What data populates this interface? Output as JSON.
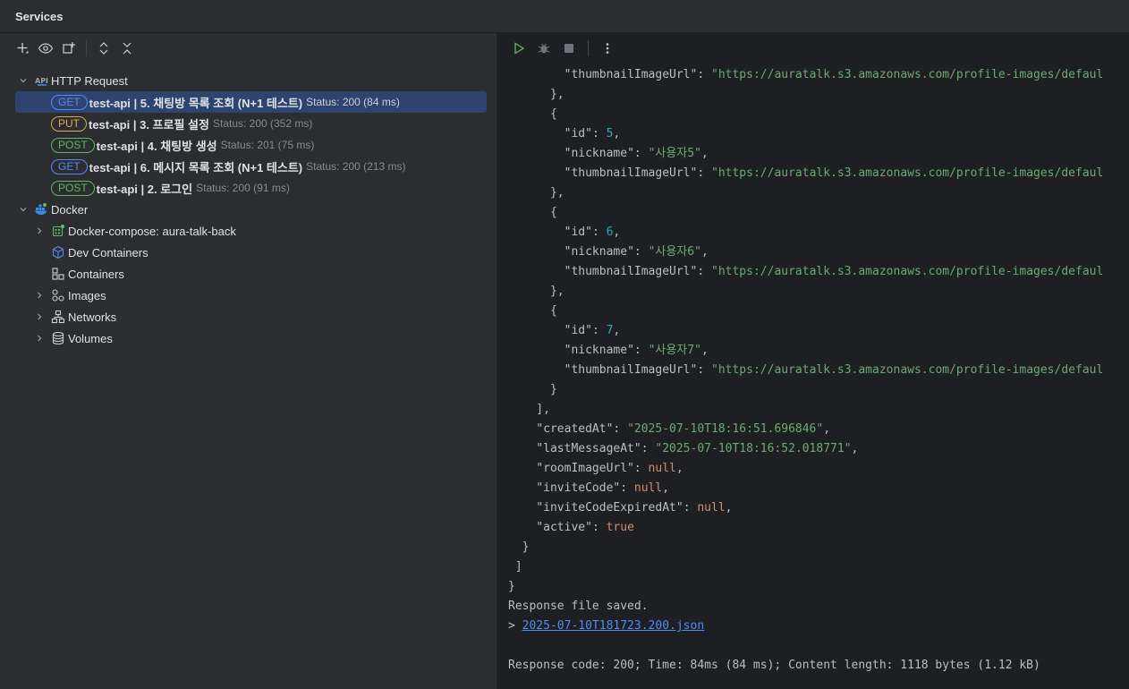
{
  "window": {
    "title": "Services"
  },
  "tree": {
    "http_group": "HTTP Request",
    "requests": [
      {
        "method": "GET",
        "name": "test-api  |  5. 채팅방 목록 조회 (N+1 테스트)",
        "status": "Status: 200 (84 ms)"
      },
      {
        "method": "PUT",
        "name": "test-api  |  3. 프로필 설정",
        "status": "Status: 200 (352 ms)"
      },
      {
        "method": "POST",
        "name": "test-api  |  4. 채팅방 생성",
        "status": "Status: 201 (75 ms)"
      },
      {
        "method": "GET",
        "name": "test-api  |  6. 메시지 목록 조회 (N+1 테스트)",
        "status": "Status: 200 (213 ms)"
      },
      {
        "method": "POST",
        "name": "test-api  |  2. 로그인",
        "status": "Status: 200 (91 ms)"
      }
    ],
    "docker_group": "Docker",
    "docker_items": [
      {
        "label": "Docker-compose: aura-talk-back",
        "icon": "docker-compose-icon",
        "expandable": true
      },
      {
        "label": "Dev Containers",
        "icon": "cube-icon",
        "expandable": false
      },
      {
        "label": "Containers",
        "icon": "containers-icon",
        "expandable": false
      },
      {
        "label": "Images",
        "icon": "images-icon",
        "expandable": true
      },
      {
        "label": "Networks",
        "icon": "networks-icon",
        "expandable": true
      },
      {
        "label": "Volumes",
        "icon": "volumes-icon",
        "expandable": true
      }
    ]
  },
  "console": {
    "url_text": "\"https://auratalk.s3.amazonaws.com/profile-images/defaul",
    "key_id": "\"id\"",
    "key_nickname": "\"nickname\"",
    "key_thumb": "\"thumbnailImageUrl\"",
    "users": [
      {
        "id": "5",
        "nickname": "\"사용자5\""
      },
      {
        "id": "6",
        "nickname": "\"사용자6\""
      },
      {
        "id": "7",
        "nickname": "\"사용자7\""
      }
    ],
    "createdAt_key": "\"createdAt\"",
    "createdAt_val": "\"2025-07-10T18:16:51.696846\"",
    "lastMessageAt_key": "\"lastMessageAt\"",
    "lastMessageAt_val": "\"2025-07-10T18:16:52.018771\"",
    "roomImageUrl_key": "\"roomImageUrl\"",
    "inviteCode_key": "\"inviteCode\"",
    "inviteCodeExpiredAt_key": "\"inviteCodeExpiredAt\"",
    "active_key": "\"active\"",
    "null_val": "null",
    "true_val": "true",
    "saved_msg": "Response file saved.",
    "saved_prefix": "> ",
    "saved_file": "2025-07-10T181723.200.json",
    "summary": "Response code: 200; Time: 84ms (84 ms); Content length: 1118 bytes (1.12 kB)"
  },
  "colors": {
    "get": "#548af7",
    "put": "#d6ae58",
    "post": "#5fb865",
    "selected": "#2e436e"
  }
}
